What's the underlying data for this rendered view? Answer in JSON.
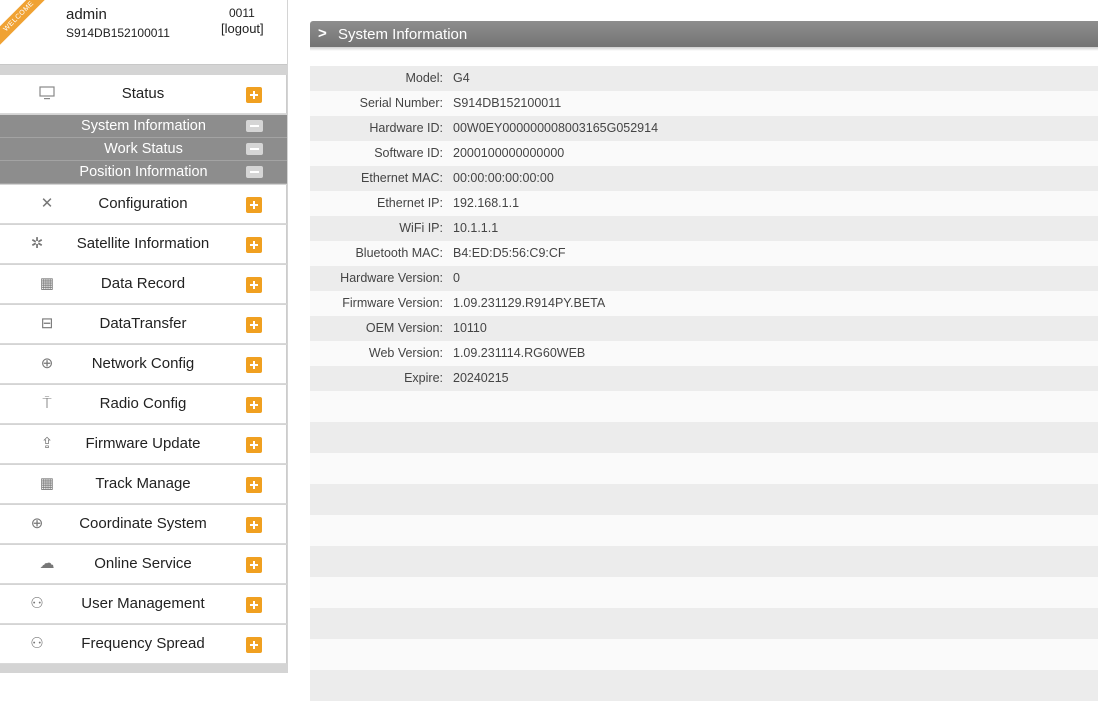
{
  "user": {
    "ribbon": "WELCOME",
    "name": "admin",
    "serial": "S914DB152100011",
    "code": "0011",
    "logout": "[logout]"
  },
  "colors": {
    "accent": "#f0a020",
    "submenu_bg": "#8d8d8d",
    "titlebar": "#808080"
  },
  "menu": {
    "status": {
      "label": "Status",
      "icon": "monitor-icon"
    },
    "submenu": [
      {
        "label": "System Information"
      },
      {
        "label": "Work Status"
      },
      {
        "label": "Position Information"
      }
    ],
    "items": [
      {
        "label": "Configuration",
        "icon": "tools-icon"
      },
      {
        "label": "Satellite Information",
        "icon": "satellite-icon"
      },
      {
        "label": "Data Record",
        "icon": "calendar-icon"
      },
      {
        "label": "DataTransfer",
        "icon": "network-icon"
      },
      {
        "label": "Network Config",
        "icon": "globe-icon"
      },
      {
        "label": "Radio Config",
        "icon": "antenna-icon"
      },
      {
        "label": "Firmware Update",
        "icon": "upload-icon"
      },
      {
        "label": "Track Manage",
        "icon": "calendar-icon"
      },
      {
        "label": "Coordinate System",
        "icon": "globe-icon"
      },
      {
        "label": "Online Service",
        "icon": "cloud-icon"
      },
      {
        "label": "User Management",
        "icon": "users-icon"
      },
      {
        "label": "Frequency Spread",
        "icon": "users-icon"
      }
    ]
  },
  "main": {
    "title": "System Information",
    "rows": [
      {
        "label": "Model:",
        "value": "G4"
      },
      {
        "label": "Serial Number:",
        "value": "S914DB152100011"
      },
      {
        "label": "Hardware ID:",
        "value": "00W0EY000000008003165G052914"
      },
      {
        "label": "Software ID:",
        "value": "2000100000000000"
      },
      {
        "label": "Ethernet MAC:",
        "value": "00:00:00:00:00:00"
      },
      {
        "label": "Ethernet IP:",
        "value": "192.168.1.1"
      },
      {
        "label": "WiFi IP:",
        "value": "10.1.1.1"
      },
      {
        "label": "Bluetooth MAC:",
        "value": "B4:ED:D5:56:C9:CF"
      },
      {
        "label": "Hardware Version:",
        "value": "0"
      },
      {
        "label": "Firmware Version:",
        "value": "1.09.231129.R914PY.BETA"
      },
      {
        "label": "OEM Version:",
        "value": "10110"
      },
      {
        "label": "Web Version:",
        "value": "1.09.231114.RG60WEB"
      },
      {
        "label": "Expire:",
        "value": "20240215"
      },
      {
        "label": "",
        "value": ""
      },
      {
        "label": "",
        "value": ""
      },
      {
        "label": "",
        "value": ""
      },
      {
        "label": "",
        "value": ""
      },
      {
        "label": "",
        "value": ""
      },
      {
        "label": "",
        "value": ""
      },
      {
        "label": "",
        "value": ""
      },
      {
        "label": "",
        "value": ""
      },
      {
        "label": "",
        "value": ""
      },
      {
        "label": "",
        "value": ""
      }
    ]
  }
}
